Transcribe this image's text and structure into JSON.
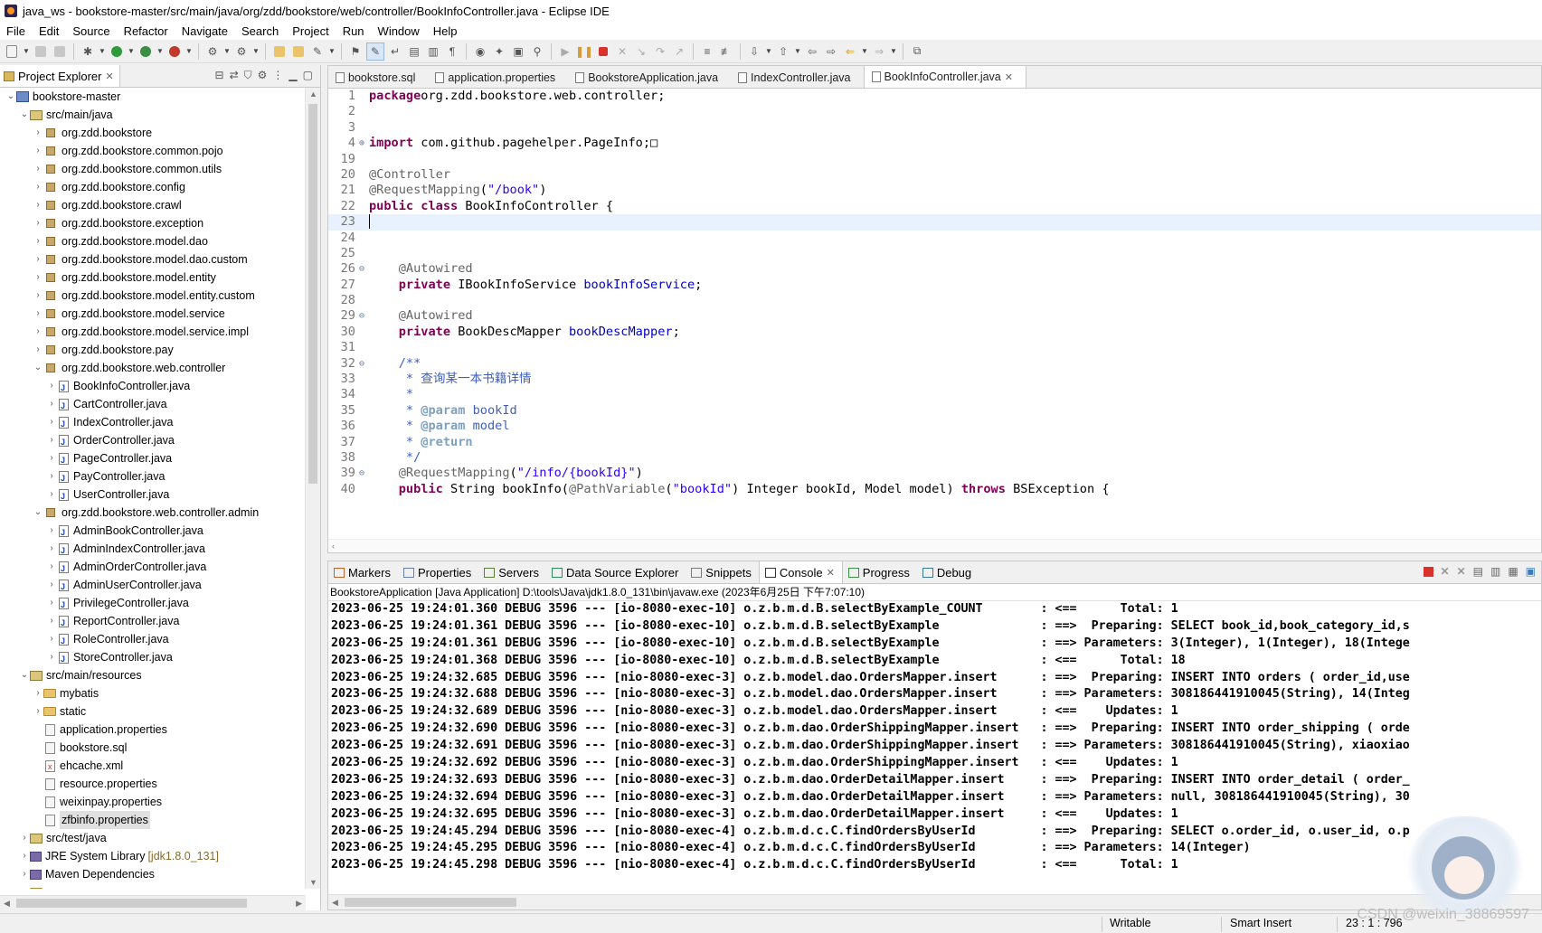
{
  "window": {
    "title": "java_ws - bookstore-master/src/main/java/org/zdd/bookstore/web/controller/BookInfoController.java - Eclipse IDE"
  },
  "menu": [
    "File",
    "Edit",
    "Source",
    "Refactor",
    "Navigate",
    "Search",
    "Project",
    "Run",
    "Window",
    "Help"
  ],
  "explorer": {
    "title": "Project Explorer",
    "rows": [
      {
        "label": "bookstore-master",
        "depth": 0,
        "tw": "⌄",
        "icon": "proj"
      },
      {
        "label": "src/main/java",
        "depth": 1,
        "tw": "⌄",
        "icon": "srcf"
      },
      {
        "label": "org.zdd.bookstore",
        "depth": 2,
        "tw": "›",
        "icon": "pkg"
      },
      {
        "label": "org.zdd.bookstore.common.pojo",
        "depth": 2,
        "tw": "›",
        "icon": "pkg"
      },
      {
        "label": "org.zdd.bookstore.common.utils",
        "depth": 2,
        "tw": "›",
        "icon": "pkg"
      },
      {
        "label": "org.zdd.bookstore.config",
        "depth": 2,
        "tw": "›",
        "icon": "pkg"
      },
      {
        "label": "org.zdd.bookstore.crawl",
        "depth": 2,
        "tw": "›",
        "icon": "pkg"
      },
      {
        "label": "org.zdd.bookstore.exception",
        "depth": 2,
        "tw": "›",
        "icon": "pkg"
      },
      {
        "label": "org.zdd.bookstore.model.dao",
        "depth": 2,
        "tw": "›",
        "icon": "pkg"
      },
      {
        "label": "org.zdd.bookstore.model.dao.custom",
        "depth": 2,
        "tw": "›",
        "icon": "pkg"
      },
      {
        "label": "org.zdd.bookstore.model.entity",
        "depth": 2,
        "tw": "›",
        "icon": "pkg"
      },
      {
        "label": "org.zdd.bookstore.model.entity.custom",
        "depth": 2,
        "tw": "›",
        "icon": "pkg"
      },
      {
        "label": "org.zdd.bookstore.model.service",
        "depth": 2,
        "tw": "›",
        "icon": "pkg"
      },
      {
        "label": "org.zdd.bookstore.model.service.impl",
        "depth": 2,
        "tw": "›",
        "icon": "pkg"
      },
      {
        "label": "org.zdd.bookstore.pay",
        "depth": 2,
        "tw": "›",
        "icon": "pkg"
      },
      {
        "label": "org.zdd.bookstore.web.controller",
        "depth": 2,
        "tw": "⌄",
        "icon": "pkg"
      },
      {
        "label": "BookInfoController.java",
        "depth": 3,
        "tw": "›",
        "icon": "jfile"
      },
      {
        "label": "CartController.java",
        "depth": 3,
        "tw": "›",
        "icon": "jfile"
      },
      {
        "label": "IndexController.java",
        "depth": 3,
        "tw": "›",
        "icon": "jfile"
      },
      {
        "label": "OrderController.java",
        "depth": 3,
        "tw": "›",
        "icon": "jfile"
      },
      {
        "label": "PageController.java",
        "depth": 3,
        "tw": "›",
        "icon": "jfile"
      },
      {
        "label": "PayController.java",
        "depth": 3,
        "tw": "›",
        "icon": "jfile"
      },
      {
        "label": "UserController.java",
        "depth": 3,
        "tw": "›",
        "icon": "jfile"
      },
      {
        "label": "org.zdd.bookstore.web.controller.admin",
        "depth": 2,
        "tw": "⌄",
        "icon": "pkg"
      },
      {
        "label": "AdminBookController.java",
        "depth": 3,
        "tw": "›",
        "icon": "jfile"
      },
      {
        "label": "AdminIndexController.java",
        "depth": 3,
        "tw": "›",
        "icon": "jfile"
      },
      {
        "label": "AdminOrderController.java",
        "depth": 3,
        "tw": "›",
        "icon": "jfile"
      },
      {
        "label": "AdminUserController.java",
        "depth": 3,
        "tw": "›",
        "icon": "jfile"
      },
      {
        "label": "PrivilegeController.java",
        "depth": 3,
        "tw": "›",
        "icon": "jfile"
      },
      {
        "label": "ReportController.java",
        "depth": 3,
        "tw": "›",
        "icon": "jfile"
      },
      {
        "label": "RoleController.java",
        "depth": 3,
        "tw": "›",
        "icon": "jfile"
      },
      {
        "label": "StoreController.java",
        "depth": 3,
        "tw": "›",
        "icon": "jfile"
      },
      {
        "label": "src/main/resources",
        "depth": 1,
        "tw": "⌄",
        "icon": "srcf"
      },
      {
        "label": "mybatis",
        "depth": 2,
        "tw": "›",
        "icon": "folder"
      },
      {
        "label": "static",
        "depth": 2,
        "tw": "›",
        "icon": "folder"
      },
      {
        "label": "application.properties",
        "depth": 2,
        "tw": "",
        "icon": "txtf"
      },
      {
        "label": "bookstore.sql",
        "depth": 2,
        "tw": "",
        "icon": "txtf"
      },
      {
        "label": "ehcache.xml",
        "depth": 2,
        "tw": "",
        "icon": "xmlf"
      },
      {
        "label": "resource.properties",
        "depth": 2,
        "tw": "",
        "icon": "txtf"
      },
      {
        "label": "weixinpay.properties",
        "depth": 2,
        "tw": "",
        "icon": "txtf"
      },
      {
        "label": "zfbinfo.properties",
        "depth": 2,
        "tw": "",
        "icon": "txtf",
        "selected": true
      },
      {
        "label": "src/test/java",
        "depth": 1,
        "tw": "›",
        "icon": "srcf"
      },
      {
        "label": "JRE System Library",
        "decor": "[jdk1.8.0_131]",
        "depth": 1,
        "tw": "›",
        "icon": "lib"
      },
      {
        "label": "Maven Dependencies",
        "depth": 1,
        "tw": "›",
        "icon": "lib"
      },
      {
        "label": "src",
        "depth": 1,
        "tw": "›",
        "icon": "folder"
      }
    ]
  },
  "editor": {
    "tabs": [
      {
        "label": "bookstore.sql",
        "active": false
      },
      {
        "label": "application.properties",
        "active": false
      },
      {
        "label": "BookstoreApplication.java",
        "active": false
      },
      {
        "label": "IndexController.java",
        "active": false
      },
      {
        "label": "BookInfoController.java",
        "active": true
      }
    ],
    "lines": [
      {
        "n": "1",
        "fold": "",
        "parts": [
          [
            "kw",
            "package"
          ],
          [
            "",
            "org.zdd.bookstore.web.controller;"
          ]
        ]
      },
      {
        "n": "2",
        "parts": []
      },
      {
        "n": "3",
        "parts": []
      },
      {
        "n": "4",
        "fold": "⊕",
        "parts": [
          [
            "kw",
            "import"
          ],
          [
            "",
            " com.github.pagehelper.PageInfo;"
          ],
          [
            "",
            "□"
          ]
        ]
      },
      {
        "n": "19",
        "parts": []
      },
      {
        "n": "20",
        "parts": [
          [
            "an",
            "@Controller"
          ]
        ]
      },
      {
        "n": "21",
        "parts": [
          [
            "an",
            "@RequestMapping"
          ],
          [
            "",
            "("
          ],
          [
            "st",
            "\"/book\""
          ],
          [
            "",
            ")"
          ]
        ]
      },
      {
        "n": "22",
        "parts": [
          [
            "kw",
            "public"
          ],
          [
            "",
            " "
          ],
          [
            "kw",
            "class"
          ],
          [
            "",
            " BookInfoController {"
          ]
        ]
      },
      {
        "n": "23",
        "current": true,
        "parts": []
      },
      {
        "n": "24",
        "parts": []
      },
      {
        "n": "25",
        "parts": []
      },
      {
        "n": "26",
        "fold": "⊖",
        "parts": [
          [
            "",
            "    "
          ],
          [
            "an",
            "@Autowired"
          ]
        ]
      },
      {
        "n": "27",
        "parts": [
          [
            "",
            "    "
          ],
          [
            "kw",
            "private"
          ],
          [
            "",
            " IBookInfoService "
          ],
          [
            "fd",
            "bookInfoService"
          ],
          [
            "",
            ";"
          ]
        ]
      },
      {
        "n": "28",
        "parts": []
      },
      {
        "n": "29",
        "fold": "⊖",
        "parts": [
          [
            "",
            "    "
          ],
          [
            "an",
            "@Autowired"
          ]
        ]
      },
      {
        "n": "30",
        "parts": [
          [
            "",
            "    "
          ],
          [
            "kw",
            "private"
          ],
          [
            "",
            " BookDescMapper "
          ],
          [
            "fd",
            "bookDescMapper"
          ],
          [
            "",
            ";"
          ]
        ]
      },
      {
        "n": "31",
        "parts": []
      },
      {
        "n": "32",
        "fold": "⊖",
        "parts": [
          [
            "",
            "    "
          ],
          [
            "jd",
            "/**"
          ]
        ]
      },
      {
        "n": "33",
        "parts": [
          [
            "",
            "     "
          ],
          [
            "jd",
            "* 查询某一本书籍详情"
          ]
        ]
      },
      {
        "n": "34",
        "parts": [
          [
            "",
            "     "
          ],
          [
            "jd",
            "*"
          ]
        ]
      },
      {
        "n": "35",
        "parts": [
          [
            "",
            "     "
          ],
          [
            "jd",
            "* "
          ],
          [
            "jt",
            "@param"
          ],
          [
            "jd",
            " bookId"
          ]
        ]
      },
      {
        "n": "36",
        "parts": [
          [
            "",
            "     "
          ],
          [
            "jd",
            "* "
          ],
          [
            "jt",
            "@param"
          ],
          [
            "jd",
            " model"
          ]
        ]
      },
      {
        "n": "37",
        "parts": [
          [
            "",
            "     "
          ],
          [
            "jd",
            "* "
          ],
          [
            "jt",
            "@return"
          ]
        ]
      },
      {
        "n": "38",
        "parts": [
          [
            "",
            "     "
          ],
          [
            "jd",
            "*/"
          ]
        ]
      },
      {
        "n": "39",
        "fold": "⊖",
        "parts": [
          [
            "",
            "    "
          ],
          [
            "an",
            "@RequestMapping"
          ],
          [
            "",
            "("
          ],
          [
            "st",
            "\"/info/{bookId}\""
          ],
          [
            "",
            ")"
          ]
        ]
      },
      {
        "n": "40",
        "parts": [
          [
            "",
            "    "
          ],
          [
            "kw",
            "public"
          ],
          [
            "",
            " String bookInfo("
          ],
          [
            "an",
            "@PathVariable"
          ],
          [
            "",
            "("
          ],
          [
            "st",
            "\"bookId\""
          ],
          [
            "",
            ") Integer "
          ],
          [
            "",
            "bookId"
          ],
          [
            "",
            ", Model "
          ],
          [
            "",
            "model"
          ],
          [
            "",
            ") "
          ],
          [
            "kw",
            "throws"
          ],
          [
            "",
            " BSException {"
          ]
        ]
      }
    ]
  },
  "console": {
    "tabs": [
      {
        "label": "Markers",
        "active": false
      },
      {
        "label": "Properties",
        "active": false
      },
      {
        "label": "Servers",
        "active": false
      },
      {
        "label": "Data Source Explorer",
        "active": false
      },
      {
        "label": "Snippets",
        "active": false
      },
      {
        "label": "Console",
        "active": true
      },
      {
        "label": "Progress",
        "active": false
      },
      {
        "label": "Debug",
        "active": false
      }
    ],
    "description": "BookstoreApplication [Java Application] D:\\tools\\Java\\jdk1.8.0_131\\bin\\javaw.exe  (2023年6月25日 下午7:07:10)",
    "lines": [
      "2023-06-25 19:24:01.360 DEBUG 3596 --- [io-8080-exec-10] o.z.b.m.d.B.selectByExample_COUNT        : <==      Total: 1",
      "2023-06-25 19:24:01.361 DEBUG 3596 --- [io-8080-exec-10] o.z.b.m.d.B.selectByExample              : ==>  Preparing: SELECT book_id,book_category_id,s",
      "2023-06-25 19:24:01.361 DEBUG 3596 --- [io-8080-exec-10] o.z.b.m.d.B.selectByExample              : ==> Parameters: 3(Integer), 1(Integer), 18(Intege",
      "2023-06-25 19:24:01.368 DEBUG 3596 --- [io-8080-exec-10] o.z.b.m.d.B.selectByExample              : <==      Total: 18",
      "2023-06-25 19:24:32.685 DEBUG 3596 --- [nio-8080-exec-3] o.z.b.model.dao.OrdersMapper.insert      : ==>  Preparing: INSERT INTO orders ( order_id,use",
      "2023-06-25 19:24:32.688 DEBUG 3596 --- [nio-8080-exec-3] o.z.b.model.dao.OrdersMapper.insert      : ==> Parameters: 308186441910045(String), 14(Integ",
      "2023-06-25 19:24:32.689 DEBUG 3596 --- [nio-8080-exec-3] o.z.b.model.dao.OrdersMapper.insert      : <==    Updates: 1",
      "2023-06-25 19:24:32.690 DEBUG 3596 --- [nio-8080-exec-3] o.z.b.m.dao.OrderShippingMapper.insert   : ==>  Preparing: INSERT INTO order_shipping ( orde",
      "2023-06-25 19:24:32.691 DEBUG 3596 --- [nio-8080-exec-3] o.z.b.m.dao.OrderShippingMapper.insert   : ==> Parameters: 308186441910045(String), xiaoxiao",
      "2023-06-25 19:24:32.692 DEBUG 3596 --- [nio-8080-exec-3] o.z.b.m.dao.OrderShippingMapper.insert   : <==    Updates: 1",
      "2023-06-25 19:24:32.693 DEBUG 3596 --- [nio-8080-exec-3] o.z.b.m.dao.OrderDetailMapper.insert     : ==>  Preparing: INSERT INTO order_detail ( order_",
      "2023-06-25 19:24:32.694 DEBUG 3596 --- [nio-8080-exec-3] o.z.b.m.dao.OrderDetailMapper.insert     : ==> Parameters: null, 308186441910045(String), 30",
      "2023-06-25 19:24:32.695 DEBUG 3596 --- [nio-8080-exec-3] o.z.b.m.dao.OrderDetailMapper.insert     : <==    Updates: 1",
      "2023-06-25 19:24:45.294 DEBUG 3596 --- [nio-8080-exec-4] o.z.b.m.d.c.C.findOrdersByUserId         : ==>  Preparing: SELECT o.order_id, o.user_id, o.p",
      "2023-06-25 19:24:45.295 DEBUG 3596 --- [nio-8080-exec-4] o.z.b.m.d.c.C.findOrdersByUserId         : ==> Parameters: 14(Integer)",
      "2023-06-25 19:24:45.298 DEBUG 3596 --- [nio-8080-exec-4] o.z.b.m.d.c.C.findOrdersByUserId         : <==      Total: 1"
    ]
  },
  "status": {
    "writable": "Writable",
    "insert_mode": "Smart Insert",
    "position": "23 : 1 : 796"
  },
  "watermark": "CSDN @weixin_38869597"
}
